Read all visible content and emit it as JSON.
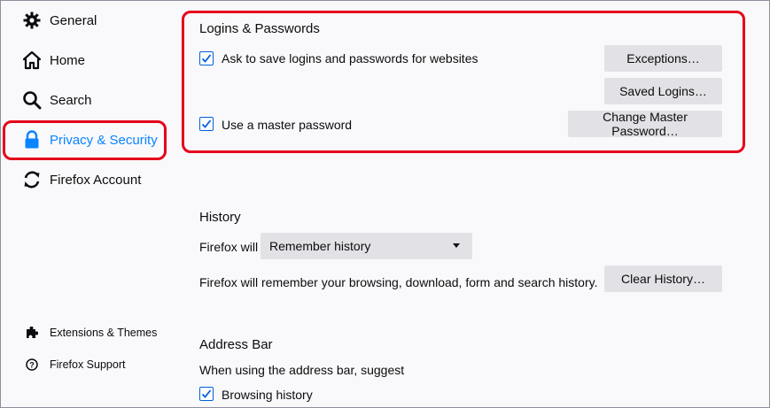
{
  "sidebar": {
    "items": [
      {
        "label": "General",
        "icon": "gear-icon"
      },
      {
        "label": "Home",
        "icon": "home-icon"
      },
      {
        "label": "Search",
        "icon": "search-icon"
      },
      {
        "label": "Privacy & Security",
        "icon": "lock-icon"
      },
      {
        "label": "Firefox Account",
        "icon": "sync-icon"
      }
    ],
    "footer": [
      {
        "label": "Extensions & Themes",
        "icon": "puzzle-icon"
      },
      {
        "label": "Firefox Support",
        "icon": "help-icon"
      }
    ]
  },
  "logins": {
    "title": "Logins & Passwords",
    "ask_label": "Ask to save logins and passwords for websites",
    "ask_checked": true,
    "exceptions_button": "Exceptions…",
    "saved_logins_button": "Saved Logins…",
    "master_label": "Use a master password",
    "master_checked": true,
    "change_master_button": "Change Master Password…"
  },
  "history": {
    "title": "History",
    "firefox_will_label": "Firefox will",
    "select_value": "Remember history",
    "description": "Firefox will remember your browsing, download, form and search history.",
    "clear_button": "Clear History…"
  },
  "address_bar": {
    "title": "Address Bar",
    "subtitle": "When using the address bar, suggest",
    "browsing_history_label": "Browsing history",
    "browsing_history_checked": true
  },
  "colors": {
    "accent": "#0a84ff",
    "highlight": "#e5001a",
    "button_bg": "#e2e2e6"
  }
}
